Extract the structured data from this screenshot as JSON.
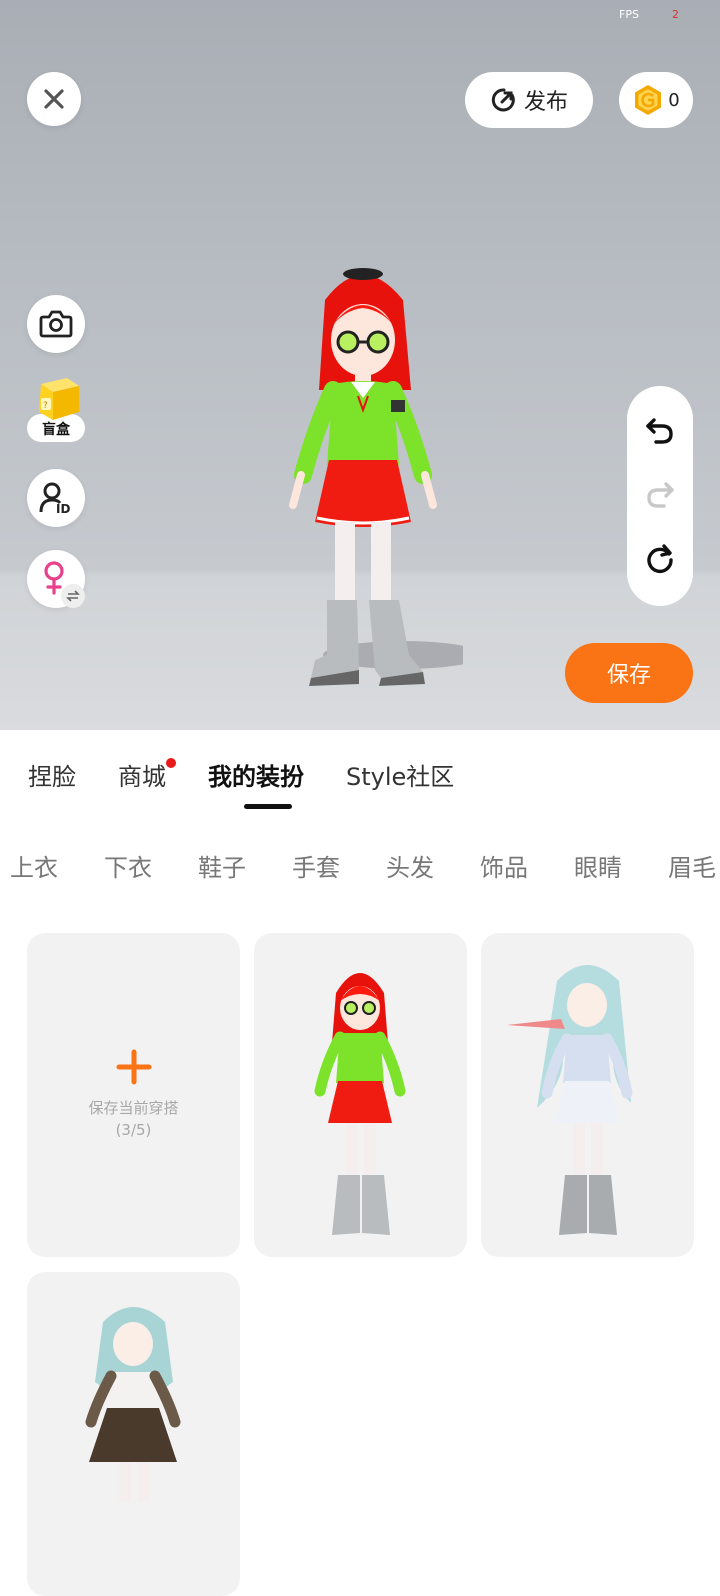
{
  "hud": {
    "fps_label": "FPS",
    "fps_value": "2"
  },
  "top": {
    "publish_label": "发布",
    "coin_count": "0"
  },
  "side": {
    "blindbox_label": "盲盒"
  },
  "actions": {
    "save_label": "保存"
  },
  "tabs": [
    {
      "label": "捏脸"
    },
    {
      "label": "商城"
    },
    {
      "label": "我的装扮"
    },
    {
      "label": "Style社区"
    }
  ],
  "categories": [
    "上衣",
    "下衣",
    "鞋子",
    "手套",
    "头发",
    "饰品",
    "眼睛",
    "眉毛"
  ],
  "outfits": {
    "add_label": "保存当前穿搭",
    "count": "(3/5)"
  },
  "colors": {
    "accent": "#fa7314",
    "badge": "#e81a1a"
  }
}
